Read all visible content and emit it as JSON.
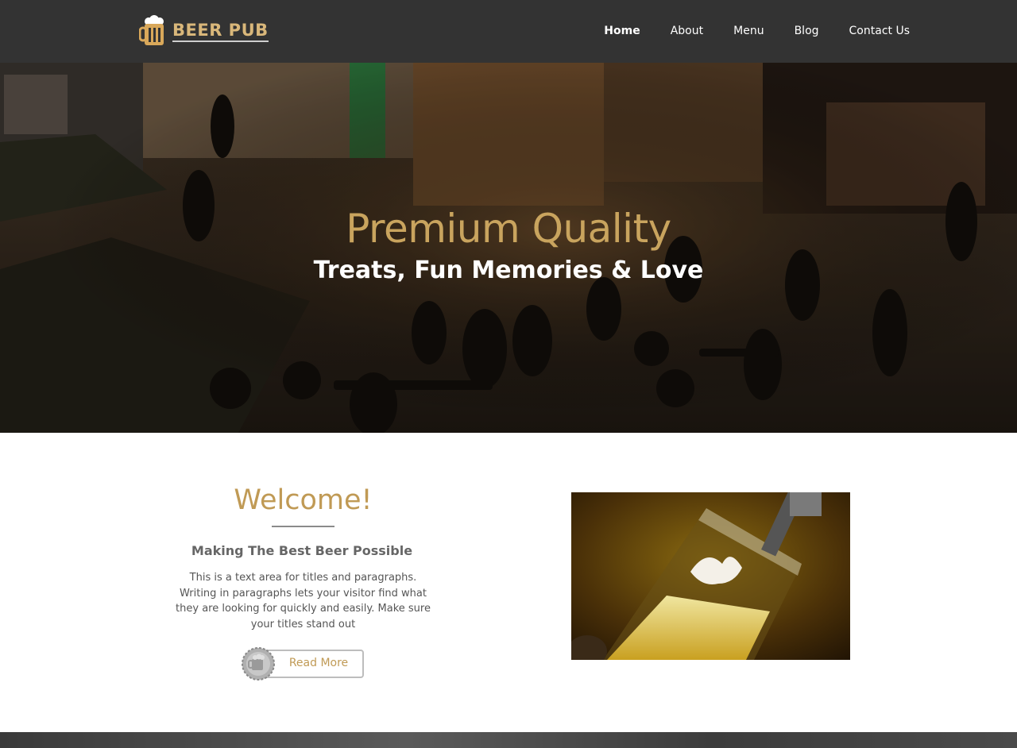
{
  "brand": {
    "name": "BEER PUB",
    "accent_color": "#c09a55",
    "header_color": "#333333"
  },
  "nav": {
    "items": [
      {
        "label": "Home",
        "active": true
      },
      {
        "label": "About",
        "active": false
      },
      {
        "label": "Menu",
        "active": false
      },
      {
        "label": "Blog",
        "active": false
      },
      {
        "label": "Contact Us",
        "active": false
      }
    ]
  },
  "hero": {
    "title": "Premium Quality",
    "subtitle": "Treats, Fun Memories & Love",
    "image_icon": "street-cafe-night-photo"
  },
  "welcome": {
    "title": "Welcome!",
    "subtitle": "Making The Best Beer Possible",
    "text": "This is a text area for titles and paragraphs. Writing in paragraphs lets your visitor find what they are looking for quickly and easily. Make sure your titles stand out",
    "button_label": "Read More",
    "button_icon": "bottle-cap-icon",
    "image_icon": "beer-pouring-photo"
  }
}
